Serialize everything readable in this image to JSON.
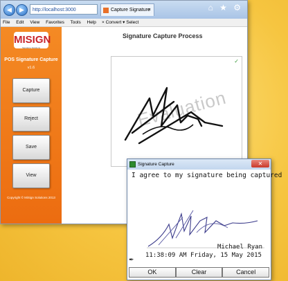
{
  "browser": {
    "address": "http://localhost:3000",
    "tab_title": "Capture Signature",
    "tab_close": "×",
    "chrome_icons": "⌂ ★ ⚙",
    "menu": [
      "File",
      "Edit",
      "View",
      "Favorites",
      "Tools",
      "Help"
    ],
    "command_bar": "× Convert ▾ Select"
  },
  "sidebar": {
    "logo": "MISIGN",
    "logo_tagline": "Signature Solutions",
    "app_title": "POS Signature Capture",
    "version": "v1.6",
    "buttons": [
      "Capture",
      "Reject",
      "Save",
      "View"
    ],
    "copyright": "Copyright © MiSign Solutions 2013"
  },
  "main": {
    "title": "Signature Capture Process",
    "watermark": "Evaluation",
    "check": "✓"
  },
  "dialog": {
    "title": "Signature Capture",
    "close": "✕",
    "agree_text": "I agree to my signature being captured",
    "signer_name": "Michael Ryan",
    "timestamp": "11:38:09 AM Friday, 15 May 2015",
    "buttons": [
      "OK",
      "Clear",
      "Cancel"
    ]
  },
  "colors": {
    "background": "#f5c33d",
    "sidebar": "#ec6c10",
    "close_button": "#c9382a"
  }
}
